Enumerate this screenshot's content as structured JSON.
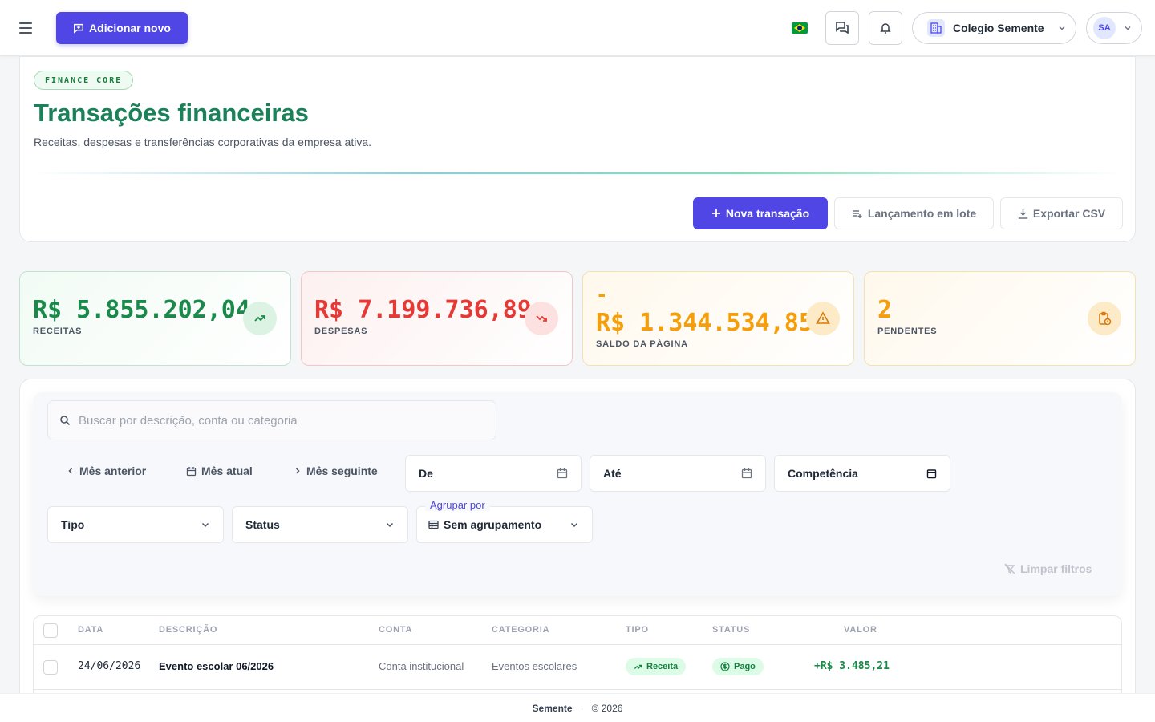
{
  "topbar": {
    "add_new_label": "Adicionar novo",
    "company_name": "Colegio Semente",
    "user_initials": "SA"
  },
  "header": {
    "badge": "FINANCE CORE",
    "title": "Transações financeiras",
    "subtitle": "Receitas, despesas e transferências corporativas da empresa ativa.",
    "actions": {
      "new_transaction": "Nova transação",
      "batch": "Lançamento em lote",
      "export": "Exportar CSV"
    }
  },
  "kpis": [
    {
      "value": "R$ 5.855.202,04",
      "label": "RECEITAS",
      "color": "#1a8a4a",
      "icon": "trending-up-icon"
    },
    {
      "value": "R$ 7.199.736,89",
      "label": "DESPESAS",
      "color": "#e53935",
      "icon": "trending-down-icon"
    },
    {
      "value_sign": "-",
      "value": "R$ 1.344.534,85",
      "label": "SALDO DA PÁGINA",
      "color": "#f59e0b",
      "icon": "alert-triangle-icon"
    },
    {
      "value": "2",
      "label": "PENDENTES",
      "color": "#f59e0b",
      "icon": "clipboard-clock-icon"
    }
  ],
  "filters": {
    "search_placeholder": "Buscar por descrição, conta ou categoria",
    "prev_month": "Mês anterior",
    "current_month": "Mês atual",
    "next_month": "Mês seguinte",
    "from_label": "De",
    "to_label": "Até",
    "competence_label": "Competência",
    "type_label": "Tipo",
    "status_label": "Status",
    "group_by_legend": "Agrupar por",
    "group_by_value": "Sem agrupamento",
    "clear_filters": "Limpar filtros"
  },
  "table": {
    "columns": [
      "DATA",
      "DESCRIÇÃO",
      "CONTA",
      "CATEGORIA",
      "TIPO",
      "STATUS",
      "VALOR"
    ],
    "rows": [
      {
        "date": "24/06/2026",
        "description": "Evento escolar 06/2026",
        "account": "Conta institucional",
        "category": "Eventos escolares",
        "type": "Receita",
        "status": "Pago",
        "value": "+R$ 3.485,21"
      }
    ]
  },
  "footer": {
    "brand": "Semente",
    "separator": "·",
    "copyright": "© 2026"
  },
  "colors": {
    "primary": "#4f46e5",
    "title_green": "#1a8158",
    "income_green": "#1a8a4a",
    "expense_red": "#e53935",
    "warning_amber": "#f59e0b"
  }
}
